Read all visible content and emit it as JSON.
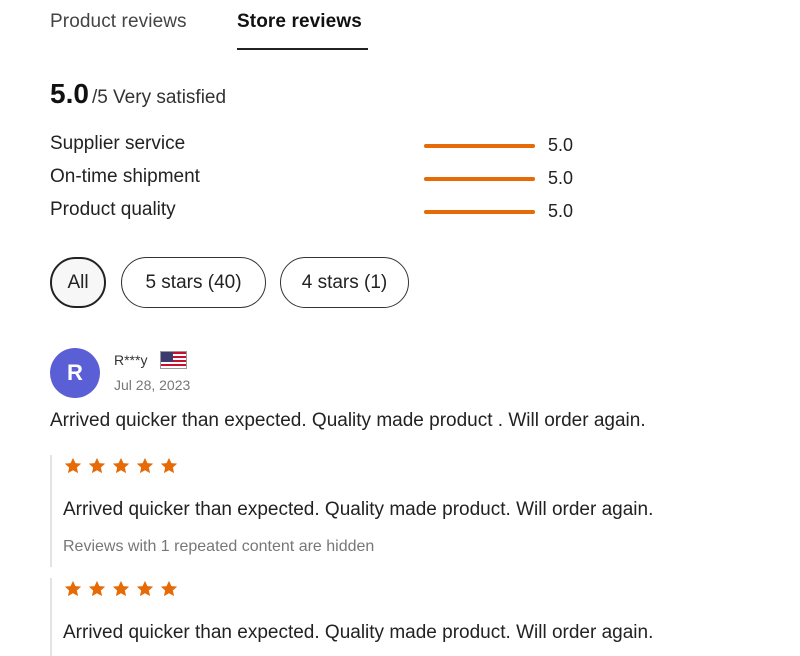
{
  "tabs": [
    {
      "label": "Product reviews",
      "active": false
    },
    {
      "label": "Store reviews",
      "active": true
    }
  ],
  "summary": {
    "score": "5.0",
    "max_and_label": "/5 Very satisfied"
  },
  "metrics": [
    {
      "label": "Supplier service",
      "value": "5.0",
      "fill_fraction": 1.0
    },
    {
      "label": "On-time shipment",
      "value": "5.0",
      "fill_fraction": 1.0
    },
    {
      "label": "Product quality",
      "value": "5.0",
      "fill_fraction": 1.0
    }
  ],
  "filters": [
    {
      "label": "All",
      "selected": true
    },
    {
      "label": "5 stars (40)",
      "selected": false
    },
    {
      "label": "4 stars (1)",
      "selected": false
    }
  ],
  "review": {
    "avatar_initial": "R",
    "reviewer": "R***y",
    "flag_icon": "us-flag-icon",
    "date": "Jul 28, 2023",
    "text": "Arrived quicker than expected. Quality made product . Will order again."
  },
  "sub_reviews": [
    {
      "stars": 5,
      "text": "Arrived quicker than expected. Quality made product. Will order again.",
      "note": "Reviews with 1 repeated content are hidden"
    },
    {
      "stars": 5,
      "text": "Arrived quicker than expected. Quality made product. Will order again."
    }
  ],
  "colors": {
    "accent": "#e66a06",
    "avatar": "#5b5fd6"
  }
}
